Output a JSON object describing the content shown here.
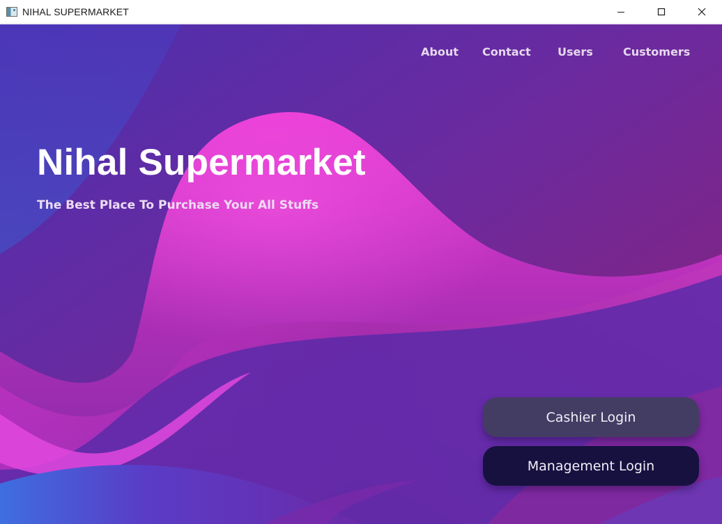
{
  "window": {
    "title": "NIHAL SUPERMARKET",
    "controls": [
      "minimize-icon",
      "maximize-icon",
      "close-icon"
    ]
  },
  "nav": {
    "items": [
      {
        "label": "About"
      },
      {
        "label": "Contact"
      },
      {
        "label": "Users"
      },
      {
        "label": "Customers"
      }
    ]
  },
  "hero": {
    "title": "Nihal Supermarket",
    "subtitle": "The Best Place To Purchase Your All Stuffs"
  },
  "actions": {
    "cashier_login": "Cashier Login",
    "management_login": "Management Login"
  },
  "colors": {
    "background_start": "#4a2ea8",
    "background_end": "#8e1f73",
    "wave_pink": "#e040d0",
    "cashier_button": "#433d63",
    "management_button": "#16113f",
    "nav_text": "#e6d8ee"
  }
}
